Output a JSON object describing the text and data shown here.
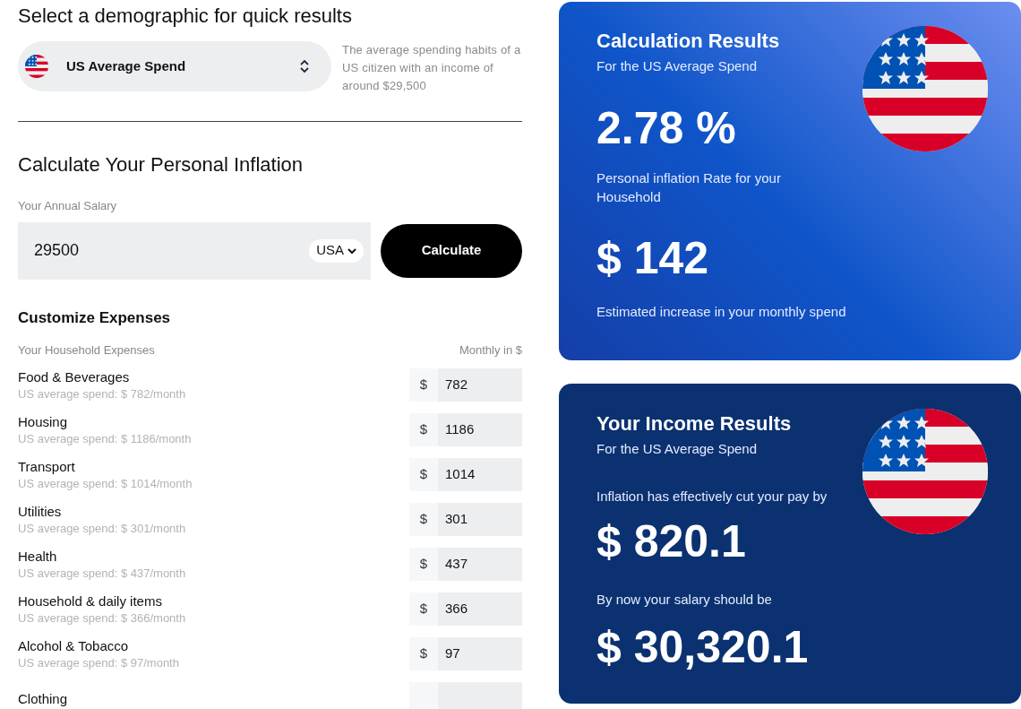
{
  "demographic": {
    "heading": "Select a demographic for quick results",
    "selected": "US Average Spend",
    "description": "The average spending habits of a US citizen with an income of around $29,500"
  },
  "calculator": {
    "heading": "Calculate Your Personal Inflation",
    "salary_label": "Your Annual Salary",
    "salary_value": "29500",
    "currency": "USA",
    "button": "Calculate"
  },
  "expenses": {
    "heading": "Customize Expenses",
    "column_left": "Your Household Expenses",
    "column_right": "Monthly in $",
    "items": [
      {
        "name": "Food & Beverages",
        "hint": "US average spend: $ 782/month",
        "currency": "$",
        "value": "782"
      },
      {
        "name": "Housing",
        "hint": "US average spend: $ 1186/month",
        "currency": "$",
        "value": "1186"
      },
      {
        "name": "Transport",
        "hint": "US average spend: $ 1014/month",
        "currency": "$",
        "value": "1014"
      },
      {
        "name": "Utilities",
        "hint": "US average spend: $ 301/month",
        "currency": "$",
        "value": "301"
      },
      {
        "name": "Health",
        "hint": "US average spend: $ 437/month",
        "currency": "$",
        "value": "437"
      },
      {
        "name": "Household & daily items",
        "hint": "US average spend: $ 366/month",
        "currency": "$",
        "value": "366"
      },
      {
        "name": "Alcohol & Tobacco",
        "hint": "US average spend: $ 97/month",
        "currency": "$",
        "value": "97"
      },
      {
        "name": "Clothing"
      }
    ]
  },
  "results": {
    "title": "Calculation Results",
    "subtitle": "For the US Average Spend",
    "rate": "2.78 %",
    "rate_caption": "Personal inflation Rate for your Household",
    "increase": "$ 142",
    "increase_caption": "Estimated increase in your monthly spend"
  },
  "income": {
    "title": "Your Income Results",
    "subtitle": "For the US Average Spend",
    "cut_caption": "Inflation has effectively cut your pay by",
    "cut": "$ 820.1",
    "salary_caption": "By now your salary should be",
    "salary": "$ 30,320.1"
  }
}
